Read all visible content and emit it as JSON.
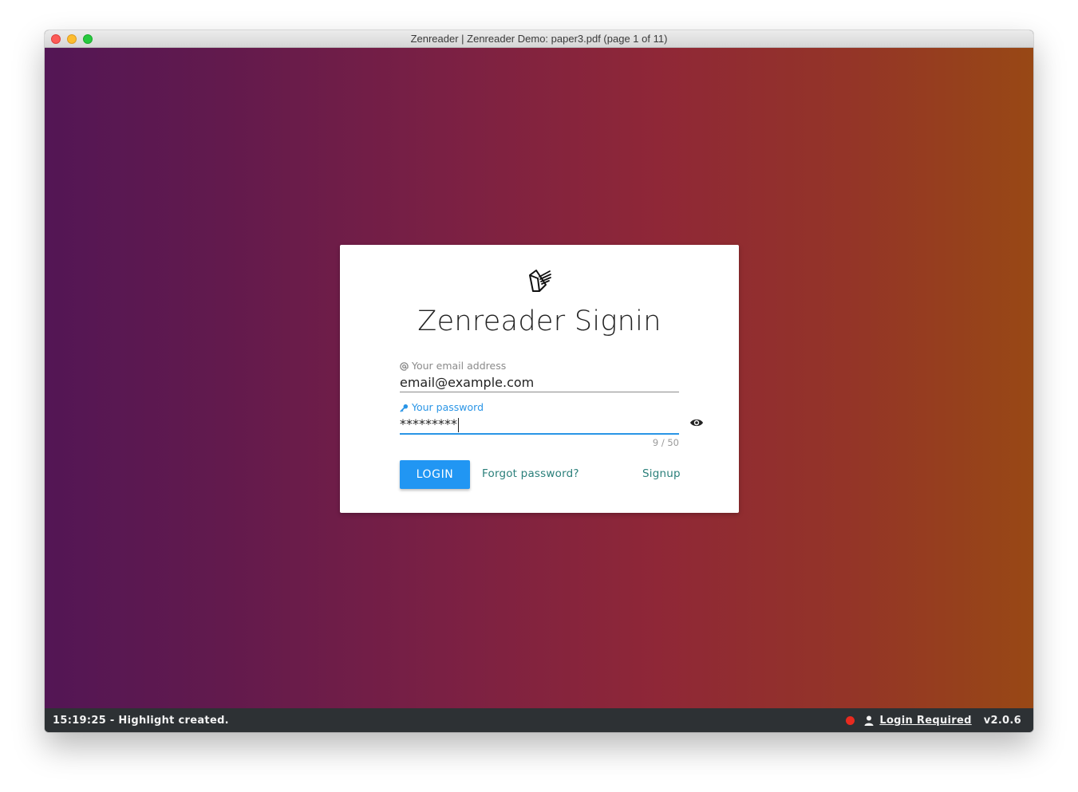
{
  "window": {
    "title": "Zenreader | Zenreader Demo: paper3.pdf (page 1 of 11)"
  },
  "card": {
    "logo_icon": "zenreader-book-logo",
    "title": "Zenreader Signin",
    "email": {
      "icon": "at-icon",
      "label": "Your email address",
      "value": "email@example.com"
    },
    "password": {
      "icon": "key-icon",
      "label": "Your password",
      "value": "*********",
      "counter": "9 / 50",
      "toggle_icon": "eye-icon"
    },
    "login_label": "LOGIN",
    "forgot_label": "Forgot password?",
    "signup_label": "Signup"
  },
  "statusbar": {
    "message": "15:19:25 - Highlight created.",
    "indicator_color": "#e82a1f",
    "login_required": "Login Required",
    "version": "v2.0.6"
  },
  "colors": {
    "accent": "#2196f3",
    "link": "#2a7f7a",
    "gradient_start": "#531655",
    "gradient_end": "#984815"
  }
}
